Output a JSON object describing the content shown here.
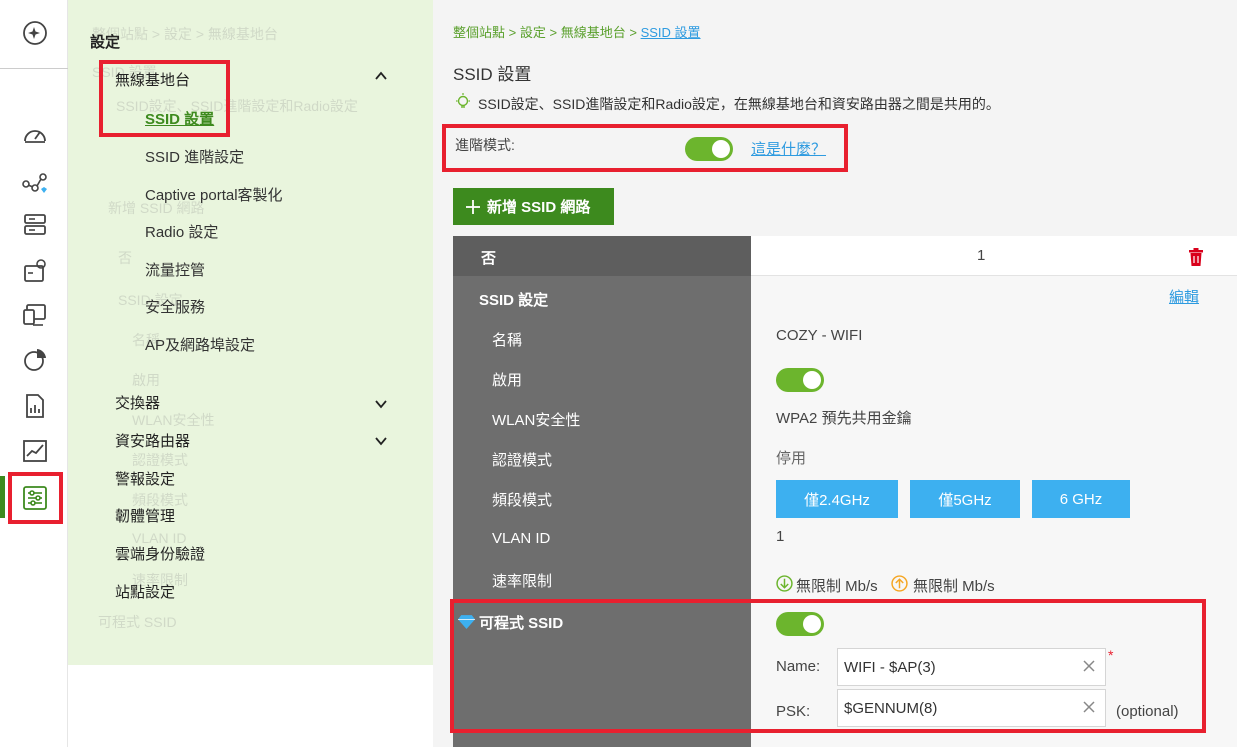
{
  "menu": {
    "header": "設定",
    "group_wireless": "無線基地台",
    "items": [
      "SSID 設置",
      "SSID 進階設定",
      "Captive portal客製化",
      "Radio 設定",
      "流量控管",
      "安全服務",
      "AP及網路埠設定"
    ],
    "switch": "交換器",
    "security_router": "資安路由器",
    "alert": "警報設定",
    "firmware": "韌體管理",
    "cloud_auth": "雲端身份驗證",
    "site_settings": "站點設定"
  },
  "ghost": {
    "g1": "整個站點 > 設定 > 無線基地台",
    "g2": "SSID 設置",
    "g3": "SSID設定、SSID進階設定和Radio設定",
    "g4": "新增 SSID 網路",
    "g5": "否",
    "g6": "SSID 設定",
    "g7": "名稱",
    "g8": "啟用",
    "g9": "WLAN安全性",
    "g10": "認證模式",
    "g11": "頻段模式",
    "g12": "VLAN ID",
    "g13": "速率限制",
    "g14": "可程式 SSID"
  },
  "breadcrumb": {
    "site": "整個站點",
    "settings": "設定",
    "wireless": "無線基地台",
    "current": "SSID 設置",
    "sep": ">"
  },
  "page": {
    "title": "SSID 設置",
    "hint": "SSID設定、SSID進階設定和Radio設定，在無線基地台和資安路由器之間是共用的。",
    "advanced_label": "進階模式:",
    "whats_this": "這是什麼？",
    "add_button": "新增 SSID 網路"
  },
  "table": {
    "header_left": "否",
    "header_no": "1",
    "section": "SSID 設定",
    "edit": "編輯",
    "rows": {
      "name_label": "名稱",
      "name_value": "COZY - WIFI",
      "enable_label": "啟用",
      "security_label": "WLAN安全性",
      "security_value": "WPA2 預先共用金鑰",
      "auth_label": "認證模式",
      "auth_value": "停用",
      "band_label": "頻段模式",
      "bands": [
        "僅2.4GHz",
        "僅5GHz",
        "6 GHz"
      ],
      "vlan_label": "VLAN ID",
      "vlan_value": "1",
      "rate_label": "速率限制",
      "rate_down": "無限制 Mb/s",
      "rate_up": "無限制 Mb/s"
    },
    "programmable": {
      "label": "可程式 SSID",
      "name_label": "Name:",
      "name_value": "WIFI - $AP(3)",
      "required": "*",
      "psk_label": "PSK:",
      "psk_value": "$GENNUM(8)",
      "optional": "(optional)"
    }
  },
  "colors": {
    "accent_green": "#6cb52d",
    "highlight_red": "#e8202f",
    "link_blue": "#2e9be0",
    "band_blue": "#3db0f0",
    "delete_red": "#d9001b"
  },
  "rail_icons": [
    "sparkle-icon",
    "dashboard-icon",
    "topology-icon",
    "server-icon",
    "device-icon",
    "monitor-icon",
    "pie-chart-icon",
    "report-icon",
    "line-chart-icon",
    "settings-sliders-icon"
  ]
}
